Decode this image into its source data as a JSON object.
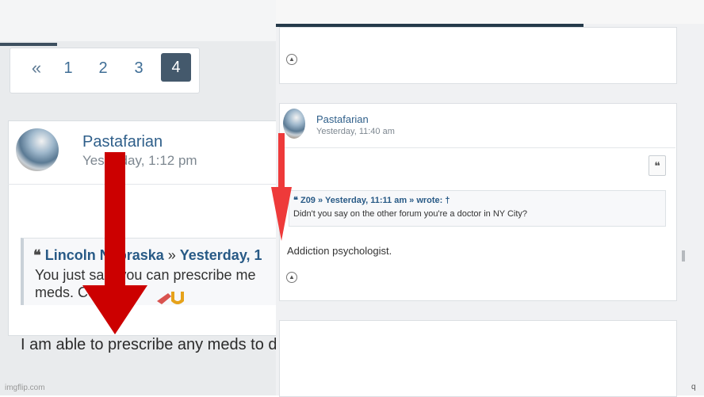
{
  "left": {
    "pagination": {
      "prev": "«",
      "pages": [
        "1",
        "2",
        "3"
      ],
      "active": "4"
    },
    "post": {
      "author": "Pastafarian",
      "time": "Yesterday, 1:12 pm",
      "quote": {
        "mark": "❝",
        "author": "Lincoln Nebraska",
        "separator": " » ",
        "time": "Yesterday, 1",
        "body": "You just said you can prescribe me meds. Cool!"
      },
      "reply": "I am able to prescribe any meds to do with addiction."
    },
    "watermark": "imgflip.com"
  },
  "right": {
    "post": {
      "author": "Pastafarian",
      "time": "Yesterday, 11:40 am",
      "quote_button": "❝",
      "quote": {
        "header": "❝ Z09 » Yesterday, 11:11 am » wrote: †",
        "body": "Didn't you say on the other forum you're a doctor in NY City?"
      },
      "reply": "Addiction psychologist."
    },
    "corner": "q"
  },
  "colors": {
    "arrow_dark": "#cc0000",
    "arrow_light": "#ee3a3a",
    "link": "#2f5f8a",
    "active_page": "#44596c"
  }
}
